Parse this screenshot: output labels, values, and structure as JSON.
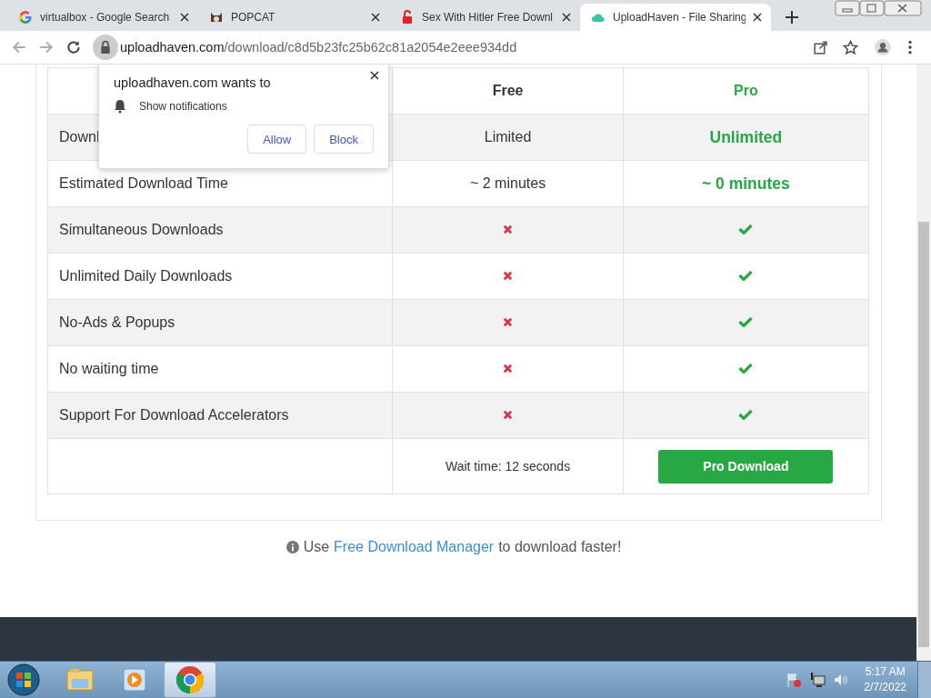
{
  "tabs": [
    {
      "title": "virtualbox - Google Search",
      "kind": "google",
      "selected": false
    },
    {
      "title": "POPCAT",
      "kind": "cat",
      "selected": false
    },
    {
      "title": "Sex With Hitler Free Downl",
      "kind": "lock",
      "selected": false
    },
    {
      "title": "UploadHaven - File Sharing",
      "kind": "cloud",
      "selected": true
    }
  ],
  "address": {
    "host": "uploadhaven.com",
    "path": "/download/c8d5b23fc25b62c81a2054e2eee934dd"
  },
  "table": {
    "columns": [
      "Free",
      "Pro"
    ],
    "rows": [
      {
        "label": "Downl",
        "free": {
          "kind": "text",
          "text": "Limited"
        },
        "pro": {
          "kind": "text",
          "text": "Unlimited"
        }
      },
      {
        "label": "Estimated Download Time",
        "free": {
          "kind": "text",
          "text": "~ 2 minutes"
        },
        "pro": {
          "kind": "text",
          "text": "~ 0 minutes"
        }
      },
      {
        "label": "Simultaneous Downloads",
        "free": {
          "kind": "cross"
        },
        "pro": {
          "kind": "check"
        }
      },
      {
        "label": "Unlimited Daily Downloads",
        "free": {
          "kind": "cross"
        },
        "pro": {
          "kind": "check"
        }
      },
      {
        "label": "No-Ads & Popups",
        "free": {
          "kind": "cross"
        },
        "pro": {
          "kind": "check"
        }
      },
      {
        "label": "No waiting time",
        "free": {
          "kind": "cross"
        },
        "pro": {
          "kind": "check"
        }
      },
      {
        "label": "Support For Download Accelerators",
        "free": {
          "kind": "cross"
        },
        "pro": {
          "kind": "check"
        }
      }
    ],
    "wait_text": "Wait time: 12 seconds",
    "pro_button": "Pro Download"
  },
  "tip": {
    "before": "Use",
    "link": "Free Download Manager",
    "after": "to download faster!"
  },
  "popup": {
    "title": "uploadhaven.com wants to",
    "permission": "Show notifications",
    "buttons": [
      "Allow",
      "Block"
    ]
  },
  "taskbar": {
    "apps": [
      {
        "kind": "explorer",
        "active": false
      },
      {
        "kind": "media",
        "active": false
      },
      {
        "kind": "chrome",
        "active": true
      }
    ],
    "time": "5:17 AM",
    "date": "2/7/2022"
  }
}
